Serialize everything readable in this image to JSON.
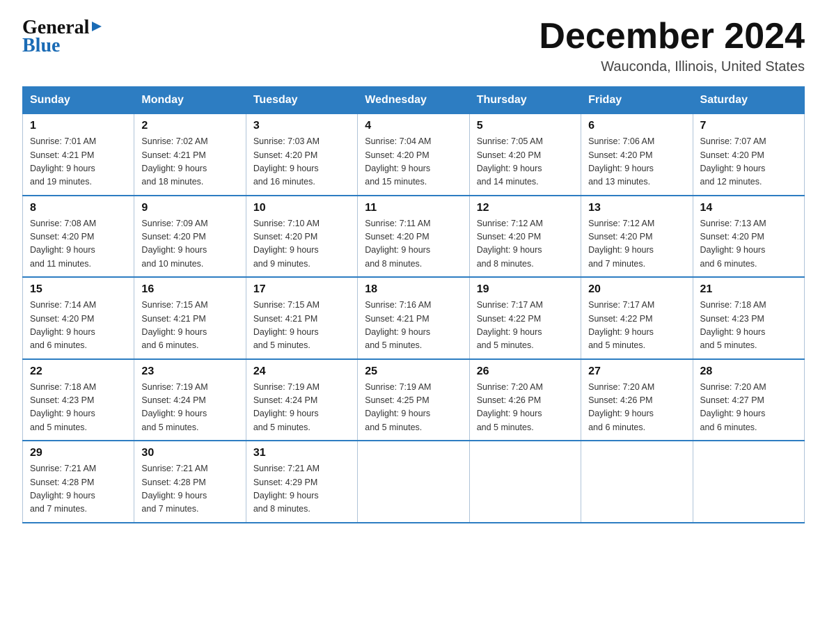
{
  "header": {
    "logo_general": "General",
    "logo_blue": "Blue",
    "month_title": "December 2024",
    "location": "Wauconda, Illinois, United States"
  },
  "days_of_week": [
    "Sunday",
    "Monday",
    "Tuesday",
    "Wednesday",
    "Thursday",
    "Friday",
    "Saturday"
  ],
  "weeks": [
    [
      {
        "day": "1",
        "sunrise": "7:01 AM",
        "sunset": "4:21 PM",
        "daylight": "9 hours and 19 minutes."
      },
      {
        "day": "2",
        "sunrise": "7:02 AM",
        "sunset": "4:21 PM",
        "daylight": "9 hours and 18 minutes."
      },
      {
        "day": "3",
        "sunrise": "7:03 AM",
        "sunset": "4:20 PM",
        "daylight": "9 hours and 16 minutes."
      },
      {
        "day": "4",
        "sunrise": "7:04 AM",
        "sunset": "4:20 PM",
        "daylight": "9 hours and 15 minutes."
      },
      {
        "day": "5",
        "sunrise": "7:05 AM",
        "sunset": "4:20 PM",
        "daylight": "9 hours and 14 minutes."
      },
      {
        "day": "6",
        "sunrise": "7:06 AM",
        "sunset": "4:20 PM",
        "daylight": "9 hours and 13 minutes."
      },
      {
        "day": "7",
        "sunrise": "7:07 AM",
        "sunset": "4:20 PM",
        "daylight": "9 hours and 12 minutes."
      }
    ],
    [
      {
        "day": "8",
        "sunrise": "7:08 AM",
        "sunset": "4:20 PM",
        "daylight": "9 hours and 11 minutes."
      },
      {
        "day": "9",
        "sunrise": "7:09 AM",
        "sunset": "4:20 PM",
        "daylight": "9 hours and 10 minutes."
      },
      {
        "day": "10",
        "sunrise": "7:10 AM",
        "sunset": "4:20 PM",
        "daylight": "9 hours and 9 minutes."
      },
      {
        "day": "11",
        "sunrise": "7:11 AM",
        "sunset": "4:20 PM",
        "daylight": "9 hours and 8 minutes."
      },
      {
        "day": "12",
        "sunrise": "7:12 AM",
        "sunset": "4:20 PM",
        "daylight": "9 hours and 8 minutes."
      },
      {
        "day": "13",
        "sunrise": "7:12 AM",
        "sunset": "4:20 PM",
        "daylight": "9 hours and 7 minutes."
      },
      {
        "day": "14",
        "sunrise": "7:13 AM",
        "sunset": "4:20 PM",
        "daylight": "9 hours and 6 minutes."
      }
    ],
    [
      {
        "day": "15",
        "sunrise": "7:14 AM",
        "sunset": "4:20 PM",
        "daylight": "9 hours and 6 minutes."
      },
      {
        "day": "16",
        "sunrise": "7:15 AM",
        "sunset": "4:21 PM",
        "daylight": "9 hours and 6 minutes."
      },
      {
        "day": "17",
        "sunrise": "7:15 AM",
        "sunset": "4:21 PM",
        "daylight": "9 hours and 5 minutes."
      },
      {
        "day": "18",
        "sunrise": "7:16 AM",
        "sunset": "4:21 PM",
        "daylight": "9 hours and 5 minutes."
      },
      {
        "day": "19",
        "sunrise": "7:17 AM",
        "sunset": "4:22 PM",
        "daylight": "9 hours and 5 minutes."
      },
      {
        "day": "20",
        "sunrise": "7:17 AM",
        "sunset": "4:22 PM",
        "daylight": "9 hours and 5 minutes."
      },
      {
        "day": "21",
        "sunrise": "7:18 AM",
        "sunset": "4:23 PM",
        "daylight": "9 hours and 5 minutes."
      }
    ],
    [
      {
        "day": "22",
        "sunrise": "7:18 AM",
        "sunset": "4:23 PM",
        "daylight": "9 hours and 5 minutes."
      },
      {
        "day": "23",
        "sunrise": "7:19 AM",
        "sunset": "4:24 PM",
        "daylight": "9 hours and 5 minutes."
      },
      {
        "day": "24",
        "sunrise": "7:19 AM",
        "sunset": "4:24 PM",
        "daylight": "9 hours and 5 minutes."
      },
      {
        "day": "25",
        "sunrise": "7:19 AM",
        "sunset": "4:25 PM",
        "daylight": "9 hours and 5 minutes."
      },
      {
        "day": "26",
        "sunrise": "7:20 AM",
        "sunset": "4:26 PM",
        "daylight": "9 hours and 5 minutes."
      },
      {
        "day": "27",
        "sunrise": "7:20 AM",
        "sunset": "4:26 PM",
        "daylight": "9 hours and 6 minutes."
      },
      {
        "day": "28",
        "sunrise": "7:20 AM",
        "sunset": "4:27 PM",
        "daylight": "9 hours and 6 minutes."
      }
    ],
    [
      {
        "day": "29",
        "sunrise": "7:21 AM",
        "sunset": "4:28 PM",
        "daylight": "9 hours and 7 minutes."
      },
      {
        "day": "30",
        "sunrise": "7:21 AM",
        "sunset": "4:28 PM",
        "daylight": "9 hours and 7 minutes."
      },
      {
        "day": "31",
        "sunrise": "7:21 AM",
        "sunset": "4:29 PM",
        "daylight": "9 hours and 8 minutes."
      },
      null,
      null,
      null,
      null
    ]
  ],
  "labels": {
    "sunrise": "Sunrise:",
    "sunset": "Sunset:",
    "daylight": "Daylight:"
  }
}
